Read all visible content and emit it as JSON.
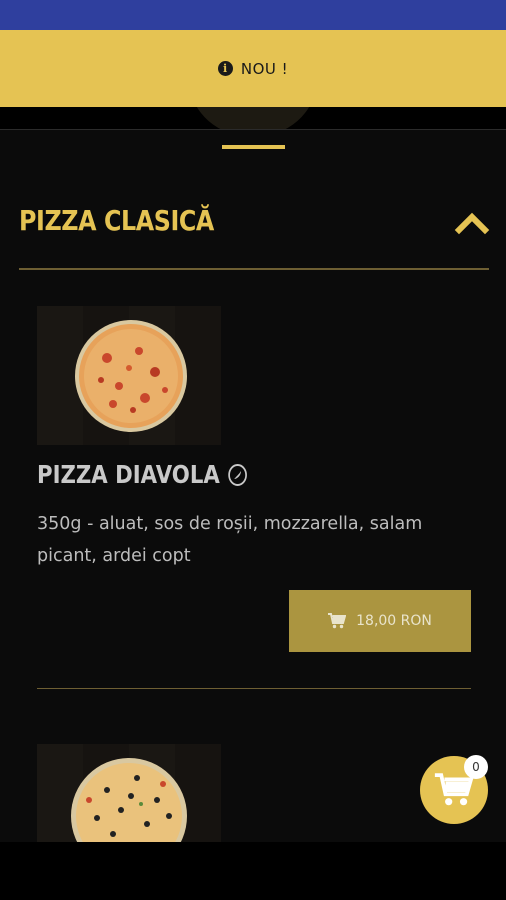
{
  "banner": {
    "text": "NOU !",
    "icon": "info-icon"
  },
  "section": {
    "title": "PIZZA CLASICĂ",
    "collapse_icon": "chevron-up-icon"
  },
  "products": [
    {
      "name": "PIZZA DIAVOLA",
      "badge_icon": "spicy-icon",
      "description": "350g - aluat, sos de roșii, mozzarella, salam picant, ardei copt",
      "price": "18,00 RON",
      "cart_icon": "cart-icon"
    },
    {
      "name": "",
      "image": "pizza-photo"
    }
  ],
  "cart": {
    "count": "0"
  },
  "colors": {
    "accent": "#e5c353",
    "price_button": "#ab9540",
    "status_bar": "#2f3f9e",
    "background": "#0b0b0b"
  }
}
